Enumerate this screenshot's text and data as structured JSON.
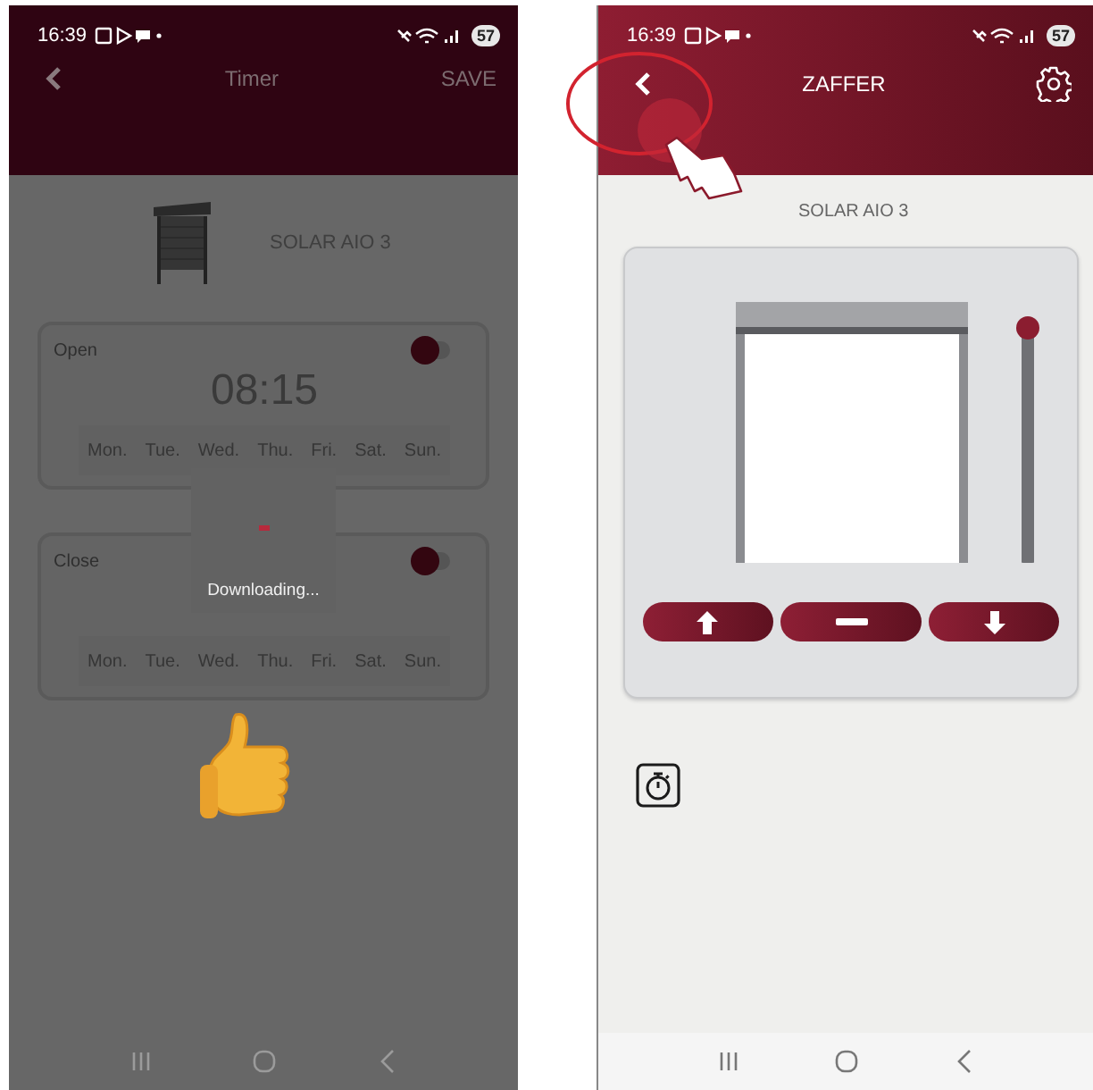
{
  "timer_screen": {
    "status_bar": {
      "time": "16:39",
      "battery": "57"
    },
    "header": {
      "title": "Timer",
      "action": "SAVE"
    },
    "device": {
      "name": "SOLAR AIO 3"
    },
    "timers": [
      {
        "label": "Open",
        "time": "08:15",
        "on": false,
        "days": [
          "Mon.",
          "Tue.",
          "Wed.",
          "Thu.",
          "Fri.",
          "Sat.",
          "Sun."
        ]
      },
      {
        "label": "Close",
        "on": false,
        "days": [
          "Mon.",
          "Tue.",
          "Wed.",
          "Thu.",
          "Fri.",
          "Sat.",
          "Sun."
        ]
      }
    ],
    "loading": {
      "message": "Downloading..."
    }
  },
  "device_screen": {
    "status_bar": {
      "time": "16:39",
      "battery": "57"
    },
    "header": {
      "title": "ZAFFER"
    },
    "device": {
      "name": "SOLAR AIO 3"
    },
    "position": {
      "level": 1
    }
  }
}
